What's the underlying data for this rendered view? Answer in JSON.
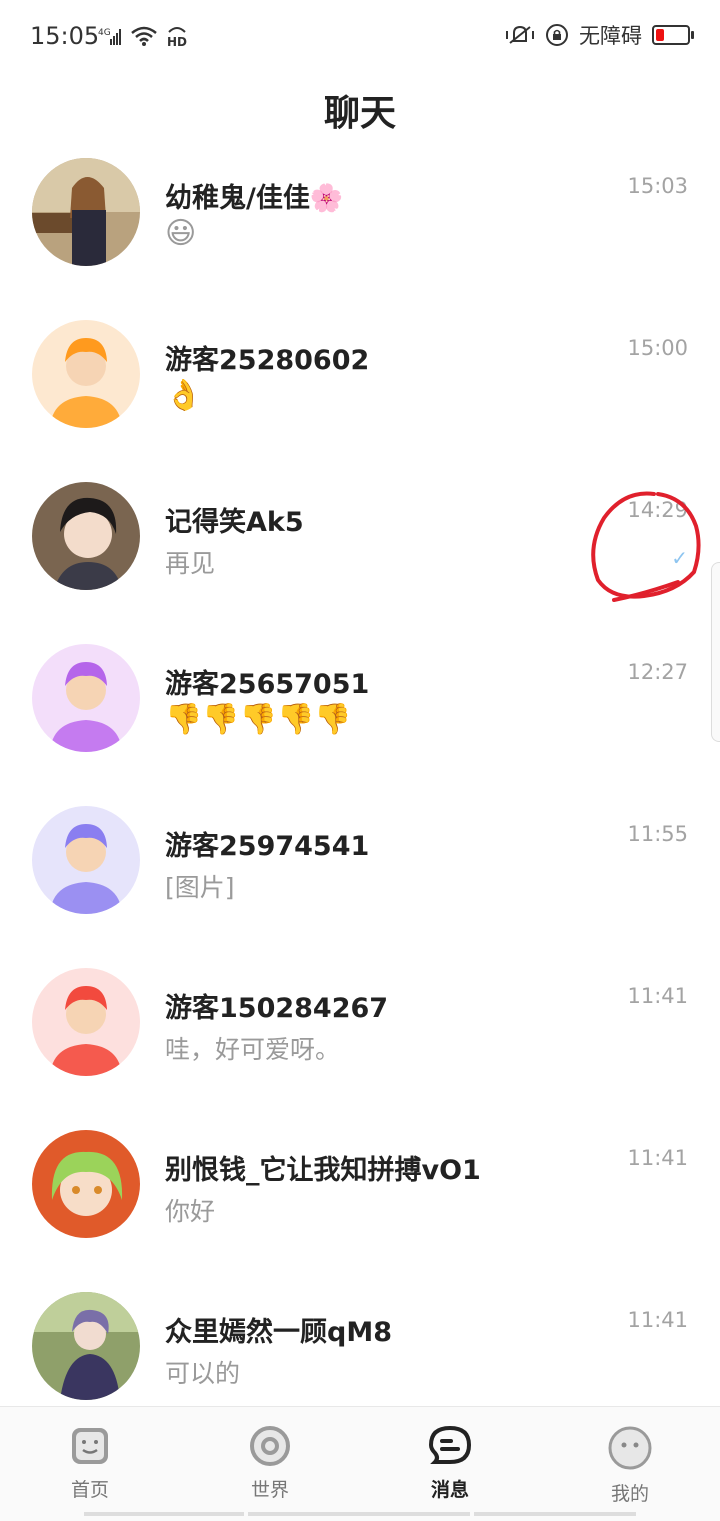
{
  "status_bar": {
    "time": "15:05",
    "network": "4G",
    "accessibility": "无障碍",
    "battery_color": "#e11111"
  },
  "header": {
    "title": "聊天"
  },
  "chats": [
    {
      "name": "幼稚鬼/佳佳🌸",
      "message": "😃",
      "time": "15:03"
    },
    {
      "name": "游客25280602",
      "message": "👌",
      "time": "15:00"
    },
    {
      "name": "记得笑Ak5",
      "message": "再见",
      "time": "14:29",
      "read_mark": "✓"
    },
    {
      "name": "游客25657051",
      "message": "👎👎👎👎👎",
      "time": "12:27"
    },
    {
      "name": "游客25974541",
      "message": "[图片]",
      "time": "11:55"
    },
    {
      "name": "游客150284267",
      "message": "哇，好可爱呀。",
      "time": "11:41"
    },
    {
      "name": "别恨钱_它让我知拼搏vO1",
      "message": "你好",
      "time": "11:41"
    },
    {
      "name": "众里嫣然一顾qM8",
      "message": "可以的",
      "time": "11:41"
    }
  ],
  "tabs": [
    {
      "label": "首页",
      "icon": "home-icon"
    },
    {
      "label": "世界",
      "icon": "world-icon"
    },
    {
      "label": "消息",
      "icon": "message-icon",
      "active": true
    },
    {
      "label": "我的",
      "icon": "profile-icon"
    }
  ],
  "colors": {
    "annotation": "#e0202c",
    "accent_blue": "#8ec5f0"
  }
}
